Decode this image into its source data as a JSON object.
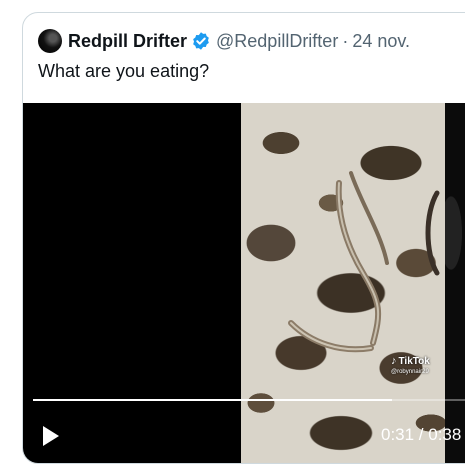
{
  "tweet": {
    "display_name": "Redpill Drifter",
    "handle": "@RedpillDrifter",
    "separator": "·",
    "date": "24 nov.",
    "text": "What are you eating?",
    "verified_color": "#1d9bf0"
  },
  "video": {
    "watermark_brand": "TikTok",
    "watermark_user": "@robynnair29",
    "time": "0:31 / 0:38",
    "progress": 0.816,
    "play_icon": "play-icon"
  }
}
